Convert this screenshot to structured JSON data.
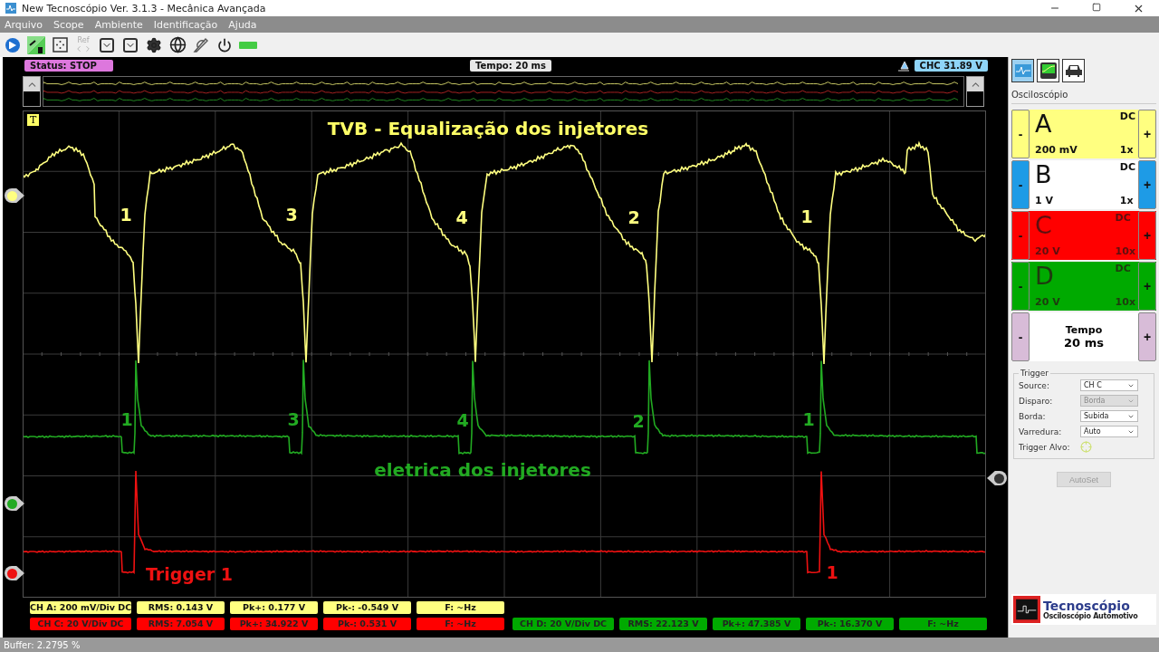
{
  "window": {
    "title": "New Tecnoscópio Ver. 3.1.3  - Mecânica Avançada"
  },
  "menu": [
    "Arquivo",
    "Scope",
    "Ambiente",
    "Identificação",
    "Ajuda"
  ],
  "toolbar": {
    "ref_label": "Ref"
  },
  "scope": {
    "status": "Status: STOP",
    "timebase": "Tempo: 20 ms",
    "trigger_level": "CHC 31.89 V",
    "trigger_badge": "T",
    "annotations": [
      {
        "text": "TVB - Equalização dos injetores",
        "color": "#ffff66"
      },
      {
        "text": "eletrica dos injetores",
        "color": "#22aa22"
      }
    ],
    "traces": [
      {
        "color": "#ffff80",
        "labels": [
          "1",
          "3",
          "4",
          "2",
          "1"
        ]
      },
      {
        "color": "#22aa22",
        "labels": [
          "1",
          "3",
          "4",
          "2",
          "1"
        ]
      },
      {
        "color": "#ee1111",
        "labels": [
          "Trigger 1",
          "1"
        ]
      }
    ]
  },
  "measurements": [
    {
      "color": "#ffff80",
      "cells": [
        "CH A: 200 mV/Div DC",
        "RMS: 0.143 V",
        "Pk+: 0.177 V",
        "Pk-: -0.549 V",
        "F: ~Hz"
      ]
    },
    {
      "color": "#ff0000",
      "cells": [
        "CH C: 20 V/Div DC",
        "RMS: 7.054 V",
        "Pk+: 34.922 V",
        "Pk-: 0.531 V",
        "F: ~Hz"
      ]
    },
    {
      "color": "#00aa00",
      "cells": [
        "CH D: 20 V/Div DC",
        "RMS: 22.123 V",
        "Pk+: 47.385 V",
        "Pk-: 16.370 V",
        "F: ~Hz"
      ]
    }
  ],
  "panel": {
    "view_tabs": [
      {
        "selected": true
      },
      {
        "selected": false
      },
      {
        "selected": false
      }
    ],
    "title": "Osciloscópio",
    "channels": [
      {
        "letter": "A",
        "coupling": "DC",
        "scale": "200 mV",
        "probe": "1x",
        "color": "#ffff80",
        "kind": "filled"
      },
      {
        "letter": "B",
        "coupling": "DC",
        "scale": "1 V",
        "probe": "1x",
        "color": "#1e9be6",
        "kind": "light"
      },
      {
        "letter": "C",
        "coupling": "DC",
        "scale": "20 V",
        "probe": "10x",
        "color": "#ff0000",
        "kind": "filled"
      },
      {
        "letter": "D",
        "coupling": "DC",
        "scale": "20 V",
        "probe": "10x",
        "color": "#00aa00",
        "kind": "filled"
      }
    ],
    "timebase": {
      "label": "Tempo",
      "value": "20 ms"
    },
    "minus": "-",
    "plus": "+",
    "trigger": {
      "title": "Trigger",
      "fields": [
        {
          "label": "Source:",
          "value": "CH C",
          "disabled": false
        },
        {
          "label": "Disparo:",
          "value": "Borda",
          "disabled": true
        },
        {
          "label": "Borda:",
          "value": "Subida",
          "disabled": false
        },
        {
          "label": "Varredura:",
          "value": "Auto",
          "disabled": false
        }
      ],
      "target_label": "Trigger Alvo:"
    },
    "autoset": {
      "label": "AutoSet",
      "disabled": true
    },
    "logo": {
      "name": "Tecnoscópio",
      "tagline": "Osciloscópio Automotivo"
    }
  },
  "status_bar": {
    "text": "Buffer: 2.2795 %"
  }
}
